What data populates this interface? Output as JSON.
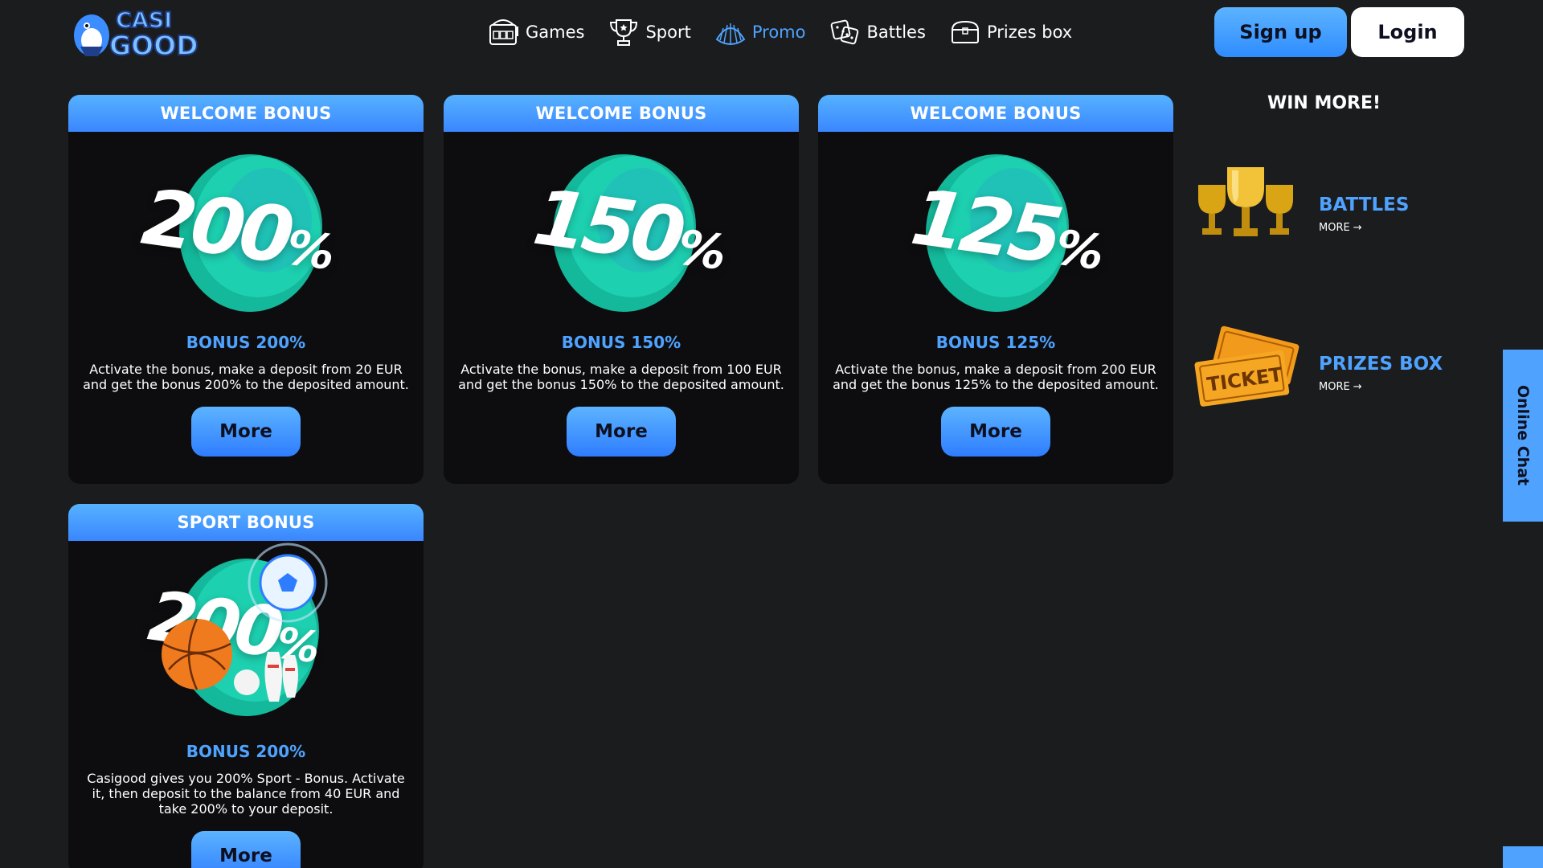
{
  "brand": {
    "logo_text_top": "CASI",
    "logo_text_bottom": "GOOD"
  },
  "nav": {
    "items": [
      {
        "label": "Games",
        "icon": "slot-machine-icon",
        "active": false
      },
      {
        "label": "Sport",
        "icon": "trophy-icon",
        "active": false
      },
      {
        "label": "Promo",
        "icon": "shell-icon",
        "active": true
      },
      {
        "label": "Battles",
        "icon": "dice-icon",
        "active": false
      },
      {
        "label": "Prizes box",
        "icon": "treasure-chest-icon",
        "active": false
      }
    ]
  },
  "auth": {
    "signup_label": "Sign up",
    "login_label": "Login"
  },
  "cards": [
    {
      "header": "WELCOME BONUS",
      "art_value": "200",
      "art_suffix": "%",
      "title": "BONUS 200%",
      "desc": "Activate the bonus, make a deposit from 20 EUR and get the bonus 200% to the deposited amount.",
      "button": "More"
    },
    {
      "header": "WELCOME BONUS",
      "art_value": "150",
      "art_suffix": "%",
      "title": "BONUS 150%",
      "desc": "Activate the bonus, make a deposit from 100 EUR and get the bonus 150% to the deposited amount.",
      "button": "More"
    },
    {
      "header": "WELCOME BONUS",
      "art_value": "125",
      "art_suffix": "%",
      "title": "BONUS 125%",
      "desc": "Activate the bonus, make a deposit from 200 EUR and get the bonus 125% to the deposited amount.",
      "button": "More"
    },
    {
      "header": "SPORT BONUS",
      "art_value": "200",
      "art_suffix": "%",
      "title": "BONUS 200%",
      "desc": "Casigood gives you 200% Sport - Bonus. Activate it, then deposit to the balance from 40 EUR and take 200% to your deposit.",
      "button": "More"
    }
  ],
  "sidebar": {
    "title": "WIN MORE!",
    "links": [
      {
        "title": "BATTLES",
        "more": "MORE",
        "icon": "trophies-icon"
      },
      {
        "title": "PRIZES BOX",
        "more": "MORE",
        "icon": "tickets-icon"
      }
    ]
  },
  "chat": {
    "label": "Online Chat"
  },
  "colors": {
    "accent": "#4fa3ff",
    "background": "#1b1c1e",
    "card": "#0d0d0f",
    "teal": "#19c9a8"
  }
}
